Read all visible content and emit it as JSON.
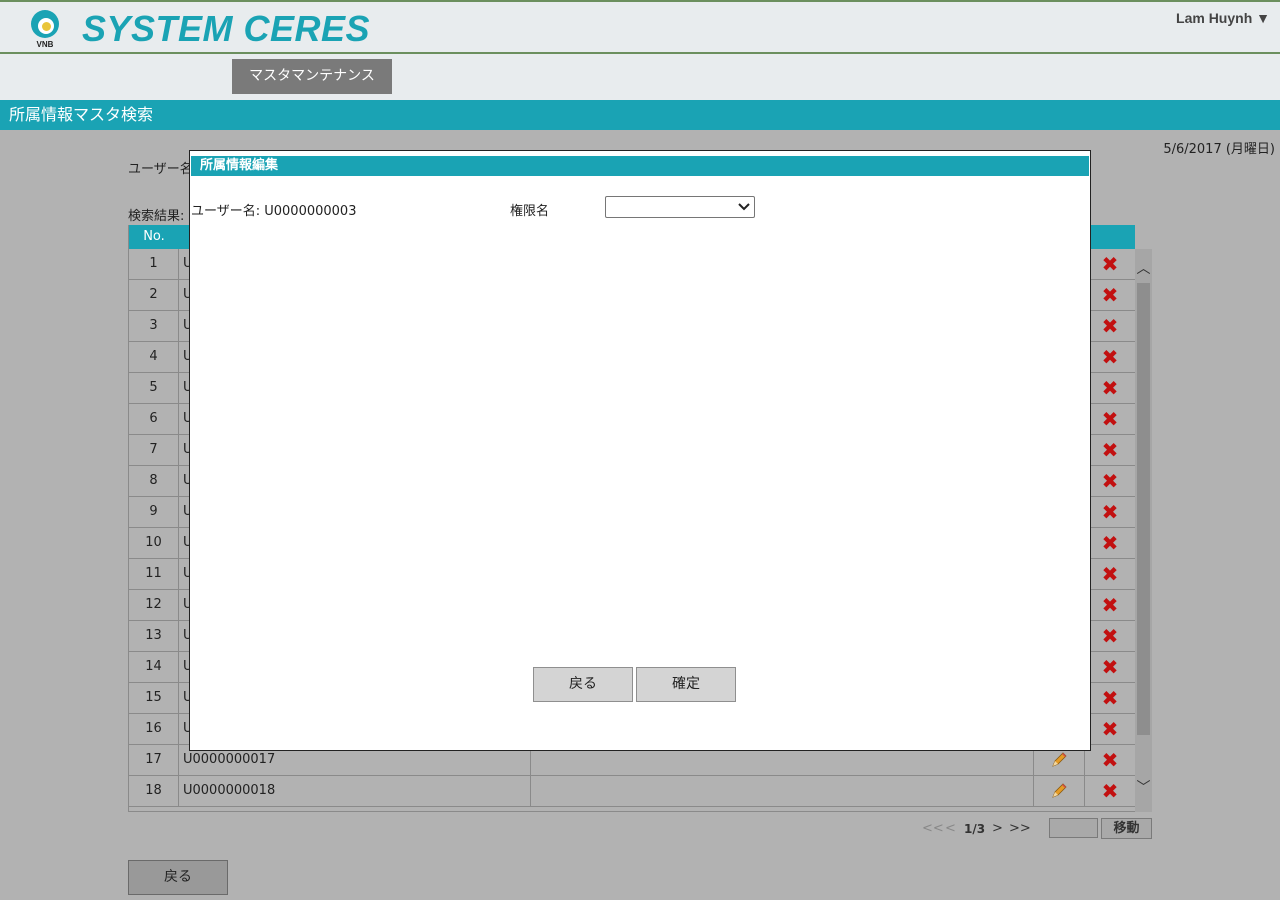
{
  "header": {
    "logo_text": "VNB",
    "brand": "SYSTEM CERES",
    "user": "Lam Huynh ▼"
  },
  "nav": {
    "master_maintenance": "マスタマンテナンス"
  },
  "page_title": "所属情報マスタ検索",
  "date": "5/6/2017 (月曜日)",
  "search": {
    "username_label": "ユーザー名"
  },
  "results": {
    "label": "検索結果:",
    "col_no": "No.",
    "rows": [
      {
        "no": "1",
        "user": "U"
      },
      {
        "no": "2",
        "user": "U"
      },
      {
        "no": "3",
        "user": "U"
      },
      {
        "no": "4",
        "user": "U"
      },
      {
        "no": "5",
        "user": "U"
      },
      {
        "no": "6",
        "user": "U"
      },
      {
        "no": "7",
        "user": "U"
      },
      {
        "no": "8",
        "user": "U"
      },
      {
        "no": "9",
        "user": "U"
      },
      {
        "no": "10",
        "user": "U"
      },
      {
        "no": "11",
        "user": "U"
      },
      {
        "no": "12",
        "user": "U"
      },
      {
        "no": "13",
        "user": "U"
      },
      {
        "no": "14",
        "user": "U"
      },
      {
        "no": "15",
        "user": "U"
      },
      {
        "no": "16",
        "user": "U"
      },
      {
        "no": "17",
        "user": "U0000000017"
      },
      {
        "no": "18",
        "user": "U0000000018"
      }
    ],
    "delete_glyph": "✖"
  },
  "pagination": {
    "first": "<<",
    "prev": "<",
    "page": "1/3",
    "next": ">",
    "last": ">>",
    "move_label": "移動",
    "page_input_value": ""
  },
  "back_label": "戻る",
  "modal": {
    "title": "所属情報編集",
    "user_label": "ユーザー名: U0000000003",
    "authority_label": "権限名",
    "authority_value": "",
    "back_label": "戻る",
    "confirm_label": "確定"
  },
  "colors": {
    "accent": "#1aa3b4",
    "delete": "#c21010",
    "header_border": "#6b8f5e"
  }
}
